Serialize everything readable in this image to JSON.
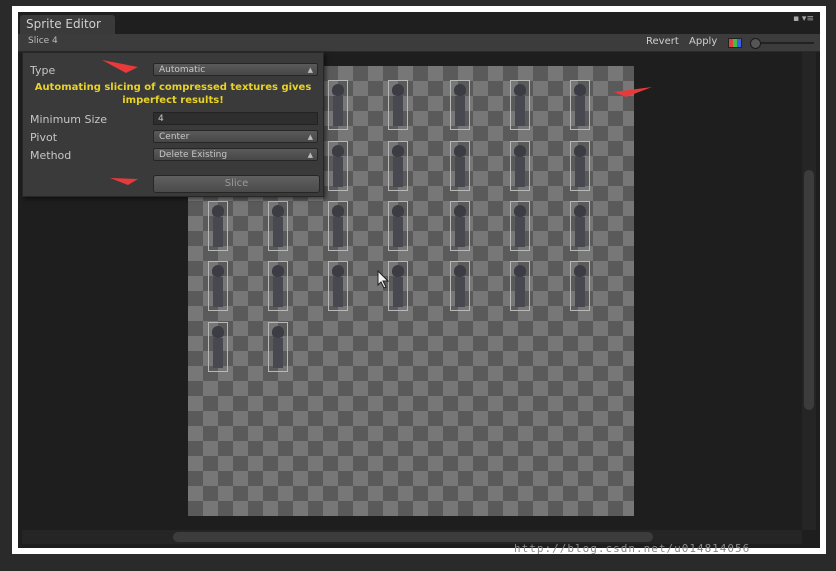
{
  "window": {
    "tab_title": "Sprite Editor",
    "slice_label": "Slice 4",
    "revert_label": "Revert",
    "apply_label": "Apply"
  },
  "slice_panel": {
    "type_label": "Type",
    "type_value": "Automatic",
    "warning_line1": "Automating slicing of compressed textures gives",
    "warning_line2": "imperfect results!",
    "min_size_label": "Minimum Size",
    "min_size_value": "4",
    "pivot_label": "Pivot",
    "pivot_value": "Center",
    "method_label": "Method",
    "method_value": "Delete Existing",
    "slice_button": "Slice"
  },
  "watermark": "http://blog.csdn.net/u014814056",
  "icons": [
    "color-channel-icon",
    "zoom-slider-knob",
    "dropdown-arrow-icon",
    "red-arrow-annotation",
    "mouse-cursor-icon"
  ],
  "colors": {
    "warning_text": "#e8d326",
    "annotation_arrow": "#e83a3a"
  }
}
